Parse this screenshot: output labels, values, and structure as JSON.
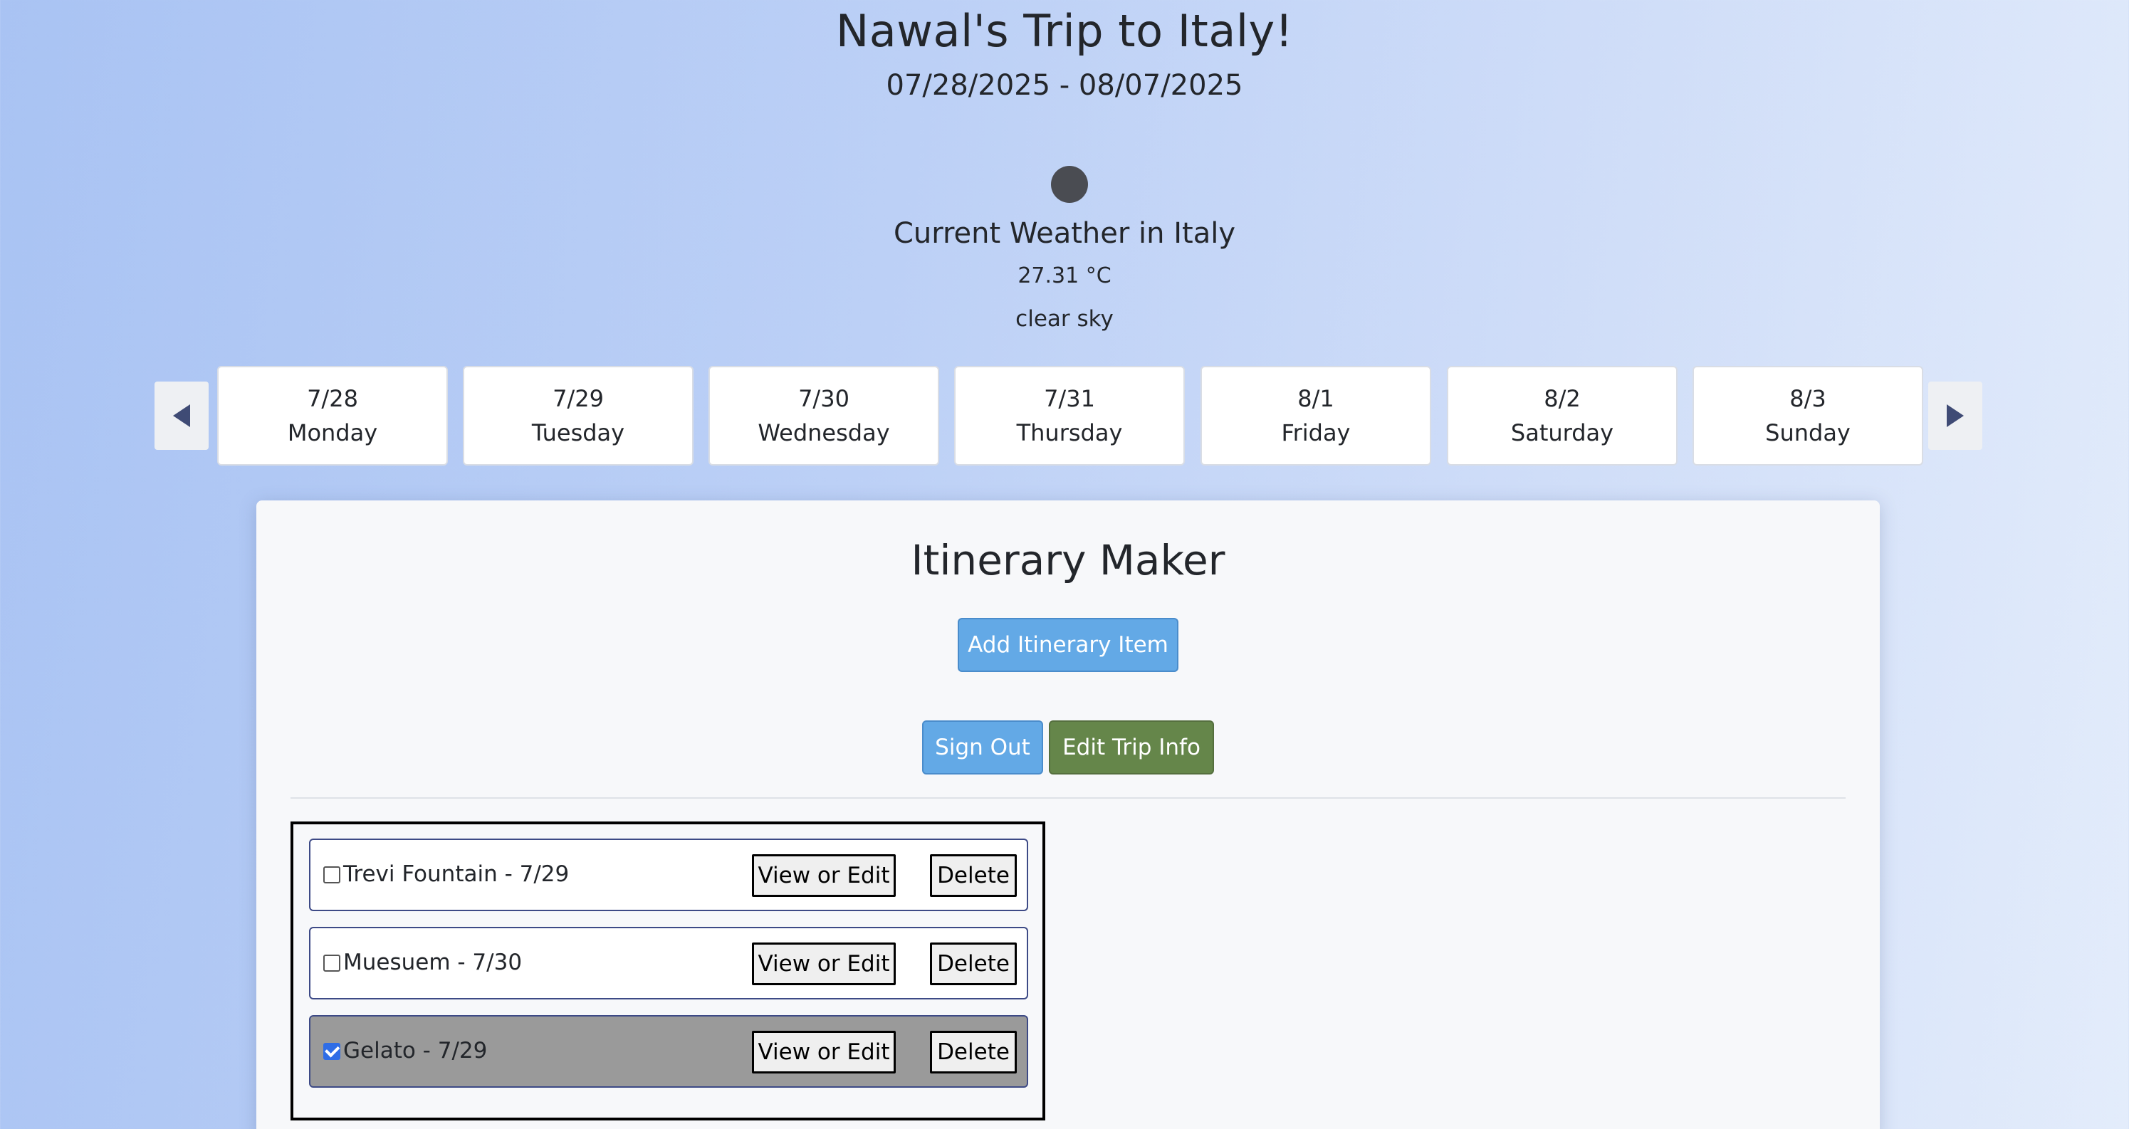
{
  "header": {
    "title": "Nawal's Trip to Italy!",
    "dates": "07/28/2025 - 08/07/2025"
  },
  "weather": {
    "icon": "weather-icon",
    "title": "Current Weather in Italy",
    "temp": "27.31 °C",
    "description": "clear sky"
  },
  "days": [
    {
      "date": "7/28",
      "name": "Monday"
    },
    {
      "date": "7/29",
      "name": "Tuesday"
    },
    {
      "date": "7/30",
      "name": "Wednesday"
    },
    {
      "date": "7/31",
      "name": "Thursday"
    },
    {
      "date": "8/1",
      "name": "Friday"
    },
    {
      "date": "8/2",
      "name": "Saturday"
    },
    {
      "date": "8/3",
      "name": "Sunday"
    }
  ],
  "panel": {
    "title": "Itinerary Maker",
    "add_label": "Add Itinerary Item",
    "signout_label": "Sign Out",
    "edittrip_label": "Edit Trip Info"
  },
  "items": [
    {
      "label": "Trevi Fountain - 7/29",
      "checked": false,
      "edit_label": "View or Edit",
      "delete_label": "Delete"
    },
    {
      "label": "Muesuem - 7/30",
      "checked": false,
      "edit_label": "View or Edit",
      "delete_label": "Delete"
    },
    {
      "label": "Gelato - 7/29",
      "checked": true,
      "edit_label": "View or Edit",
      "delete_label": "Delete"
    }
  ],
  "colors": {
    "primary_button": "#63a9e6",
    "edit_trip_button": "#65864a",
    "checkbox_checked": "#2f6de6",
    "completed_item_bg": "#9a9a9a"
  }
}
